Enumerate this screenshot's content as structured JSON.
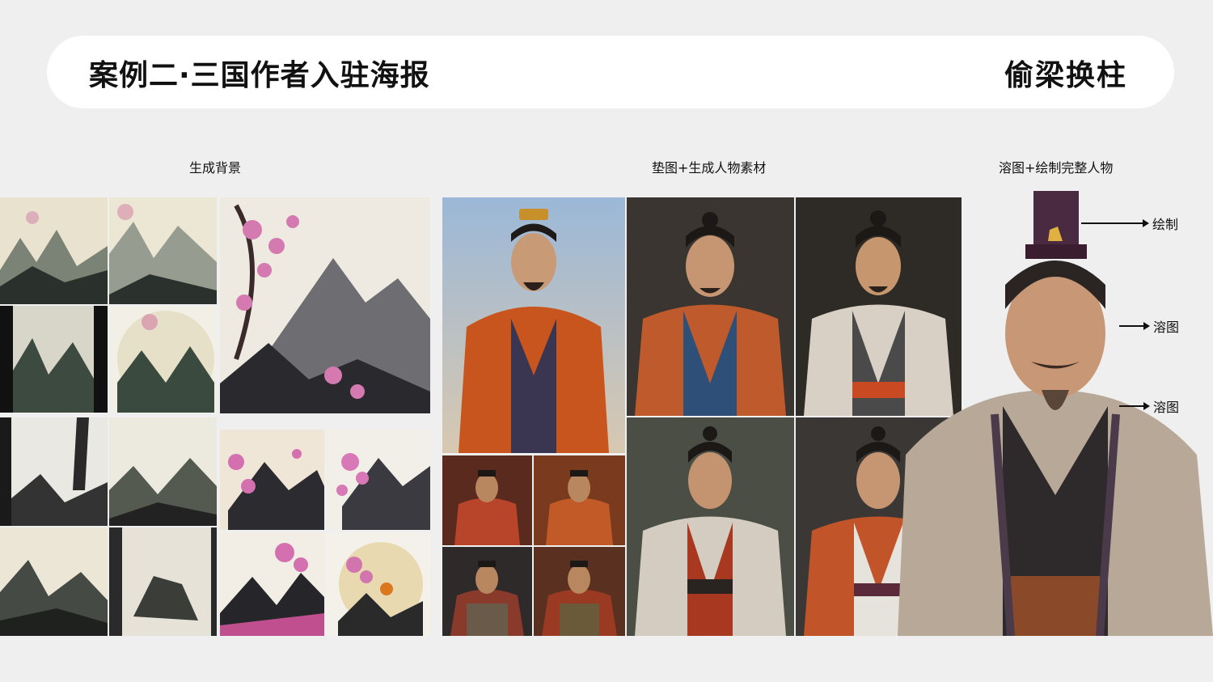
{
  "header": {
    "title": "案例二·三国作者入驻海报",
    "subtitle": "偷梁换柱"
  },
  "sections": [
    {
      "label": "生成背景"
    },
    {
      "label": "垫图+生成人物素材"
    },
    {
      "label": "溶图+绘制完整人物"
    }
  ],
  "annotations": [
    {
      "label": "绘制"
    },
    {
      "label": "溶图"
    },
    {
      "label": "溶图"
    }
  ],
  "images": {
    "backgrounds": [
      "ink-wash-mountains",
      "cherry-blossom-landscape"
    ],
    "characters": [
      "three-kingdoms-warlord-portraits"
    ]
  },
  "colors": {
    "page_bg": "#efefef",
    "header_bg": "#ffffff",
    "text": "#111111"
  }
}
